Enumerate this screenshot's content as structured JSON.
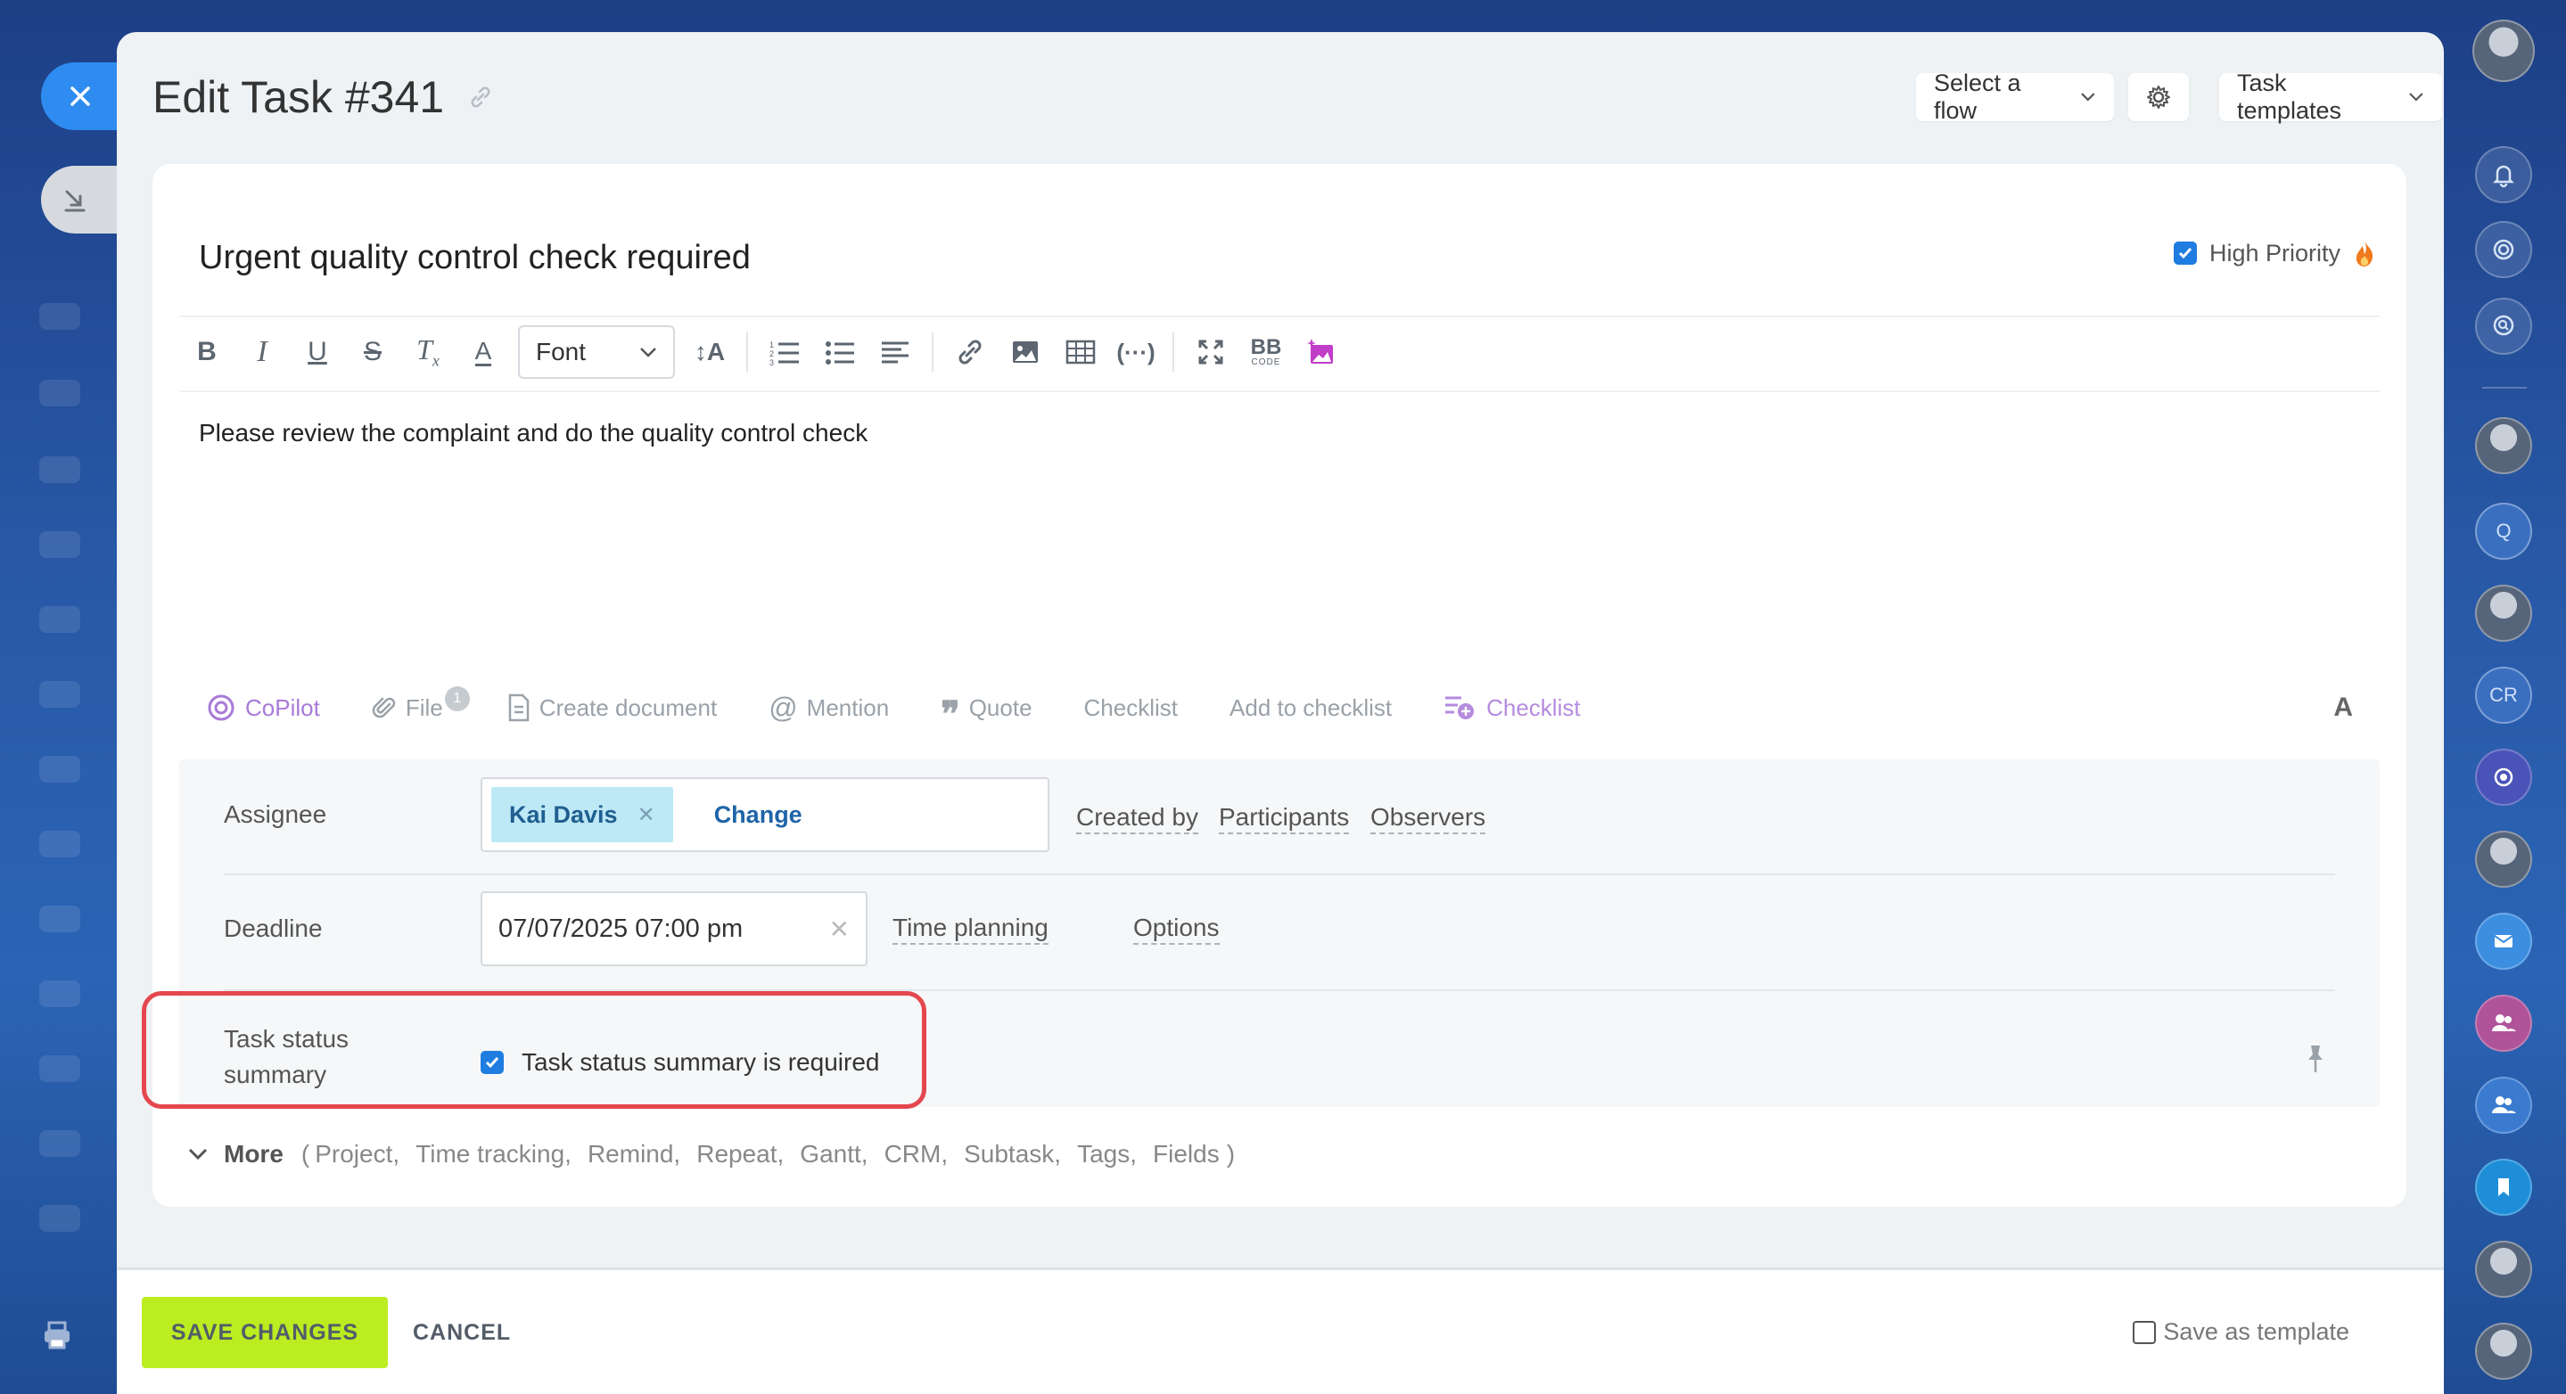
{
  "window": {
    "title": "Edit Task #341"
  },
  "header": {
    "flow_label": "Select a flow",
    "templates_label": "Task templates"
  },
  "task": {
    "title": "Urgent quality control check required",
    "high_priority_label": "High Priority",
    "high_priority_checked": true,
    "description": "Please review the complaint and do the quality control check"
  },
  "toolbar": {
    "font_label": "Font",
    "bb_code_label": "BB",
    "bb_code_sub": "CODE"
  },
  "actions": {
    "copilot": "CoPilot",
    "file": "File",
    "file_count": "1",
    "create_document": "Create document",
    "mention": "Mention",
    "quote": "Quote",
    "checklist": "Checklist",
    "add_to_checklist": "Add to checklist",
    "checklist2": "Checklist",
    "font_toggle": "A"
  },
  "form": {
    "assignee_label": "Assignee",
    "assignee_name": "Kai Davis",
    "change_label": "Change",
    "created_by": "Created by",
    "participants": "Participants",
    "observers": "Observers",
    "deadline_label": "Deadline",
    "deadline_value": "07/07/2025 07:00 pm",
    "time_planning": "Time planning",
    "options": "Options",
    "status_summary_label_1": "Task status",
    "status_summary_label_2": "summary",
    "status_summary_check": "Task status summary is required"
  },
  "more": {
    "label": "More",
    "open_paren": "(",
    "items": [
      "Project,",
      "Time tracking,",
      "Remind,",
      "Repeat,",
      "Gantt,",
      "CRM,",
      "Subtask,",
      "Tags,",
      "Fields"
    ],
    "close_paren": ")"
  },
  "footer": {
    "save_label": "SAVE CHANGES",
    "cancel_label": "CANCEL",
    "save_template_label": "Save as template"
  },
  "rail": {
    "letter_q": "Q",
    "letter_cr": "CR"
  },
  "colors": {
    "accent": "#1f7ce0",
    "save_button": "#bbed21",
    "highlight": "#e5474e",
    "chip": "#bde8f6"
  }
}
